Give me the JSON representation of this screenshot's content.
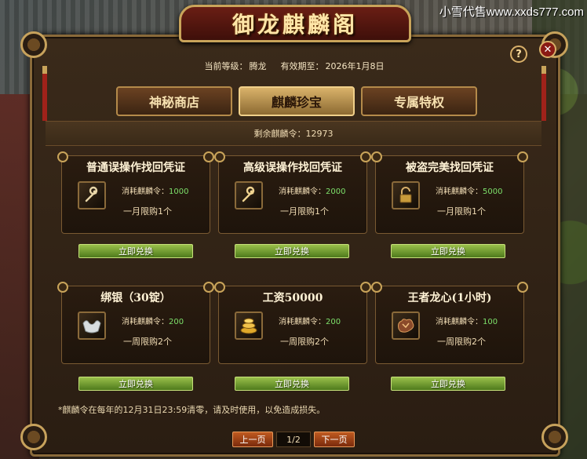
{
  "watermark": "小雪代售www.xxds777.com",
  "window": {
    "title": "御龙麒麟阁",
    "help_glyph": "?",
    "close_glyph": "✕"
  },
  "info": {
    "level_label": "当前等级：",
    "level_value": "腾龙",
    "expiry_label": "有效期至：",
    "expiry_value": "2026年1月8日"
  },
  "tabs": [
    {
      "label": "神秘商店",
      "active": false
    },
    {
      "label": "麒麟珍宝",
      "active": true
    },
    {
      "label": "专属特权",
      "active": false
    }
  ],
  "remaining": {
    "label": "剩余麒麟令：",
    "value": "12973"
  },
  "cards": [
    {
      "title": "普通误操作找回凭证",
      "icon": "wrench-icon",
      "cost_label": "消耗麒麟令：",
      "cost": "1000",
      "limit": "一月限购1个",
      "button": "立即兑换"
    },
    {
      "title": "高级误操作找回凭证",
      "icon": "wrench-icon",
      "cost_label": "消耗麒麟令：",
      "cost": "2000",
      "limit": "一月限购1个",
      "button": "立即兑换"
    },
    {
      "title": "被盗完美找回凭证",
      "icon": "lock-icon",
      "cost_label": "消耗麒麟令：",
      "cost": "5000",
      "limit": "一月限购1个",
      "button": "立即兑换"
    },
    {
      "title": "绑银（30锭）",
      "icon": "silver-ingot-icon",
      "cost_label": "消耗麒麟令：",
      "cost": "200",
      "limit": "一周限购2个",
      "button": "立即兑换"
    },
    {
      "title": "工资50000",
      "icon": "gold-coins-icon",
      "cost_label": "消耗麒麟令：",
      "cost": "200",
      "limit": "一周限购2个",
      "button": "立即兑换"
    },
    {
      "title": "王者龙心(1小时)",
      "icon": "dragon-heart-icon",
      "cost_label": "消耗麒麟令：",
      "cost": "100",
      "limit": "一周限购2个",
      "button": "立即兑换"
    }
  ],
  "notice": "*麒麟令在每年的12月31日23:59清零，请及时使用，以免造成损失。",
  "pager": {
    "prev": "上一页",
    "current": "1/2",
    "next": "下一页"
  }
}
